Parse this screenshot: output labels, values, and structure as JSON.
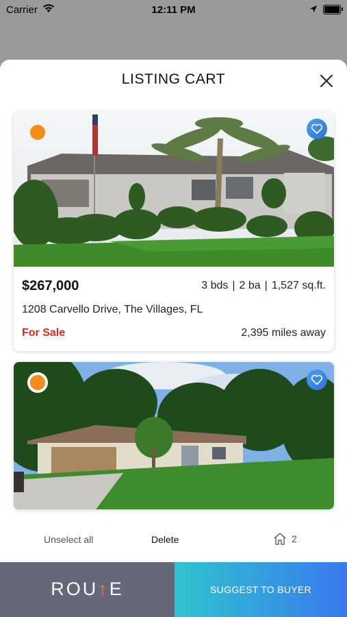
{
  "status_bar": {
    "carrier": "Carrier",
    "time": "12:11 PM"
  },
  "sheet": {
    "title": "LISTING CART"
  },
  "listings": [
    {
      "price": "$267,000",
      "beds": "3 bds",
      "baths": "2 ba",
      "sqft": "1,527 sq.ft.",
      "address": "1208 Carvello Drive, The Villages, FL",
      "status": "For Sale",
      "distance": "2,395 miles away",
      "selected": true,
      "favorite": true
    },
    {
      "selected": true,
      "favorite": true
    }
  ],
  "actions": {
    "unselect_all": "Unselect all",
    "delete": "Delete",
    "count": "2"
  },
  "bottom": {
    "logo_left": "ROU",
    "logo_arrow": "↑",
    "logo_right": "E",
    "suggest": "SUGGEST TO BUYER"
  },
  "colors": {
    "select_dot": "#f38d17",
    "for_sale": "#e0261d",
    "route_bg": "#66687a",
    "suggest_gradient": [
      "#2ec4cf",
      "#3a79ee"
    ]
  }
}
